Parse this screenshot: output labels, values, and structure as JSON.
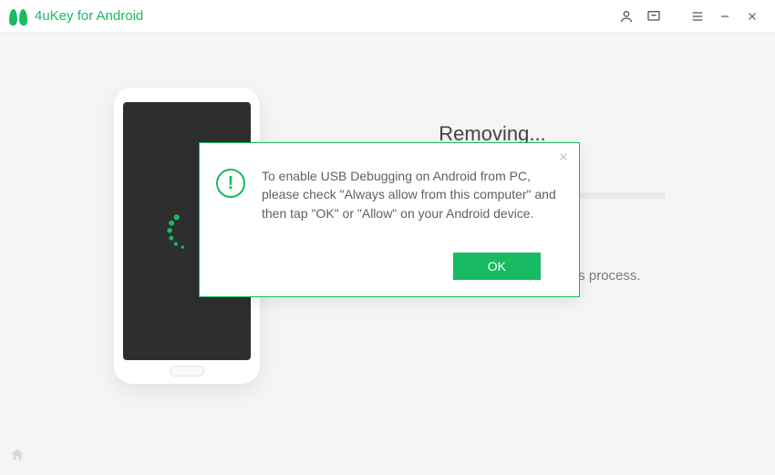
{
  "app": {
    "title": "4uKey for Android"
  },
  "main": {
    "headline": "Removing...",
    "warning": "Note: Do not disconnect your device during this process."
  },
  "dialog": {
    "message": "To enable USB Debugging on Android from PC, please check \"Always allow from this computer\" and then tap \"OK\" or \"Allow\" on your Android device.",
    "ok_label": "OK"
  },
  "colors": {
    "accent": "#18ba62"
  }
}
